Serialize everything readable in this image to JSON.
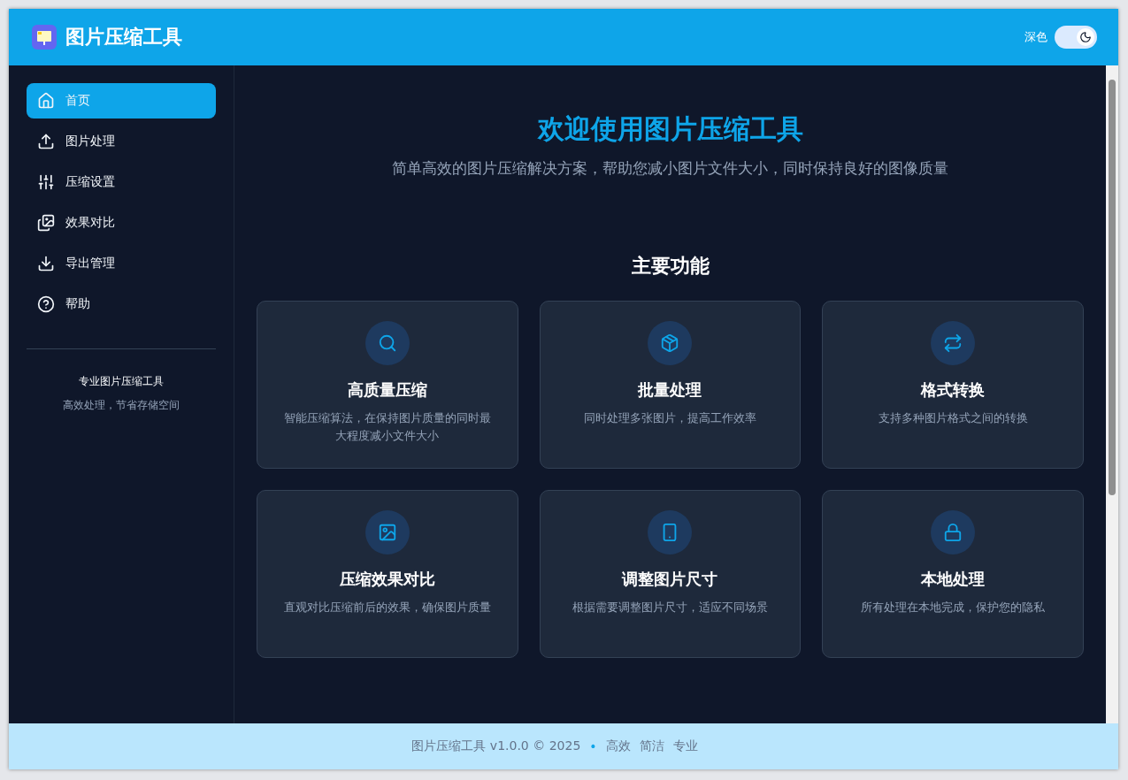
{
  "header": {
    "title": "图片压缩工具",
    "theme_label": "深色",
    "dark_mode": {
      "on": true
    }
  },
  "sidebar": {
    "items": [
      {
        "label": "首页",
        "selected": true
      },
      {
        "label": "图片处理",
        "selected": false
      },
      {
        "label": "压缩设置",
        "selected": false
      },
      {
        "label": "效果对比",
        "selected": false
      },
      {
        "label": "导出管理",
        "selected": false
      },
      {
        "label": "帮助",
        "selected": false
      }
    ],
    "footer_title": "专业图片压缩工具",
    "footer_subtitle": "高效处理，节省存储空间"
  },
  "hero": {
    "title": "欢迎使用图片压缩工具",
    "subtitle": "简单高效的图片压缩解决方案，帮助您减小图片文件大小，同时保持良好的图像质量"
  },
  "features": {
    "title": "主要功能",
    "cards": [
      {
        "title": "高质量压缩",
        "description": "智能压缩算法，在保持图片质量的同时最大程度减小文件大小"
      },
      {
        "title": "批量处理",
        "description": "同时处理多张图片，提高工作效率"
      },
      {
        "title": "格式转换",
        "description": "支持多种图片格式之间的转换"
      },
      {
        "title": "压缩效果对比",
        "description": "直观对比压缩前后的效果，确保图片质量"
      },
      {
        "title": "调整图片尺寸",
        "description": "根据需要调整图片尺寸，适应不同场景"
      },
      {
        "title": "本地处理",
        "description": "所有处理在本地完成，保护您的隐私"
      }
    ]
  },
  "footer": {
    "text": "图片压缩工具 v1.0.0 © 2025",
    "separator": "•",
    "tags": [
      "高效",
      "简洁",
      "专业"
    ]
  }
}
